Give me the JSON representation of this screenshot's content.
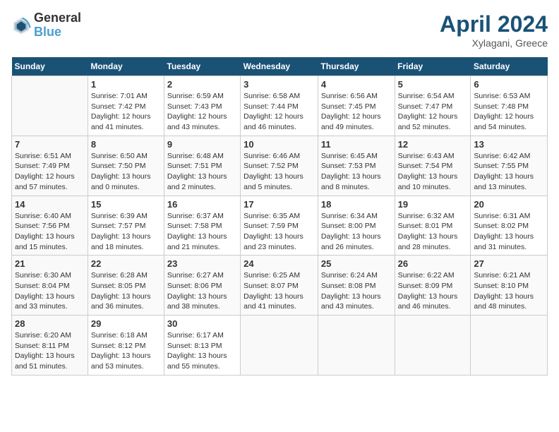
{
  "header": {
    "logo_line1": "General",
    "logo_line2": "Blue",
    "month": "April 2024",
    "location": "Xylagani, Greece"
  },
  "weekdays": [
    "Sunday",
    "Monday",
    "Tuesday",
    "Wednesday",
    "Thursday",
    "Friday",
    "Saturday"
  ],
  "weeks": [
    [
      {
        "day": "",
        "info": ""
      },
      {
        "day": "1",
        "info": "Sunrise: 7:01 AM\nSunset: 7:42 PM\nDaylight: 12 hours\nand 41 minutes."
      },
      {
        "day": "2",
        "info": "Sunrise: 6:59 AM\nSunset: 7:43 PM\nDaylight: 12 hours\nand 43 minutes."
      },
      {
        "day": "3",
        "info": "Sunrise: 6:58 AM\nSunset: 7:44 PM\nDaylight: 12 hours\nand 46 minutes."
      },
      {
        "day": "4",
        "info": "Sunrise: 6:56 AM\nSunset: 7:45 PM\nDaylight: 12 hours\nand 49 minutes."
      },
      {
        "day": "5",
        "info": "Sunrise: 6:54 AM\nSunset: 7:47 PM\nDaylight: 12 hours\nand 52 minutes."
      },
      {
        "day": "6",
        "info": "Sunrise: 6:53 AM\nSunset: 7:48 PM\nDaylight: 12 hours\nand 54 minutes."
      }
    ],
    [
      {
        "day": "7",
        "info": "Sunrise: 6:51 AM\nSunset: 7:49 PM\nDaylight: 12 hours\nand 57 minutes."
      },
      {
        "day": "8",
        "info": "Sunrise: 6:50 AM\nSunset: 7:50 PM\nDaylight: 13 hours\nand 0 minutes."
      },
      {
        "day": "9",
        "info": "Sunrise: 6:48 AM\nSunset: 7:51 PM\nDaylight: 13 hours\nand 2 minutes."
      },
      {
        "day": "10",
        "info": "Sunrise: 6:46 AM\nSunset: 7:52 PM\nDaylight: 13 hours\nand 5 minutes."
      },
      {
        "day": "11",
        "info": "Sunrise: 6:45 AM\nSunset: 7:53 PM\nDaylight: 13 hours\nand 8 minutes."
      },
      {
        "day": "12",
        "info": "Sunrise: 6:43 AM\nSunset: 7:54 PM\nDaylight: 13 hours\nand 10 minutes."
      },
      {
        "day": "13",
        "info": "Sunrise: 6:42 AM\nSunset: 7:55 PM\nDaylight: 13 hours\nand 13 minutes."
      }
    ],
    [
      {
        "day": "14",
        "info": "Sunrise: 6:40 AM\nSunset: 7:56 PM\nDaylight: 13 hours\nand 15 minutes."
      },
      {
        "day": "15",
        "info": "Sunrise: 6:39 AM\nSunset: 7:57 PM\nDaylight: 13 hours\nand 18 minutes."
      },
      {
        "day": "16",
        "info": "Sunrise: 6:37 AM\nSunset: 7:58 PM\nDaylight: 13 hours\nand 21 minutes."
      },
      {
        "day": "17",
        "info": "Sunrise: 6:35 AM\nSunset: 7:59 PM\nDaylight: 13 hours\nand 23 minutes."
      },
      {
        "day": "18",
        "info": "Sunrise: 6:34 AM\nSunset: 8:00 PM\nDaylight: 13 hours\nand 26 minutes."
      },
      {
        "day": "19",
        "info": "Sunrise: 6:32 AM\nSunset: 8:01 PM\nDaylight: 13 hours\nand 28 minutes."
      },
      {
        "day": "20",
        "info": "Sunrise: 6:31 AM\nSunset: 8:02 PM\nDaylight: 13 hours\nand 31 minutes."
      }
    ],
    [
      {
        "day": "21",
        "info": "Sunrise: 6:30 AM\nSunset: 8:04 PM\nDaylight: 13 hours\nand 33 minutes."
      },
      {
        "day": "22",
        "info": "Sunrise: 6:28 AM\nSunset: 8:05 PM\nDaylight: 13 hours\nand 36 minutes."
      },
      {
        "day": "23",
        "info": "Sunrise: 6:27 AM\nSunset: 8:06 PM\nDaylight: 13 hours\nand 38 minutes."
      },
      {
        "day": "24",
        "info": "Sunrise: 6:25 AM\nSunset: 8:07 PM\nDaylight: 13 hours\nand 41 minutes."
      },
      {
        "day": "25",
        "info": "Sunrise: 6:24 AM\nSunset: 8:08 PM\nDaylight: 13 hours\nand 43 minutes."
      },
      {
        "day": "26",
        "info": "Sunrise: 6:22 AM\nSunset: 8:09 PM\nDaylight: 13 hours\nand 46 minutes."
      },
      {
        "day": "27",
        "info": "Sunrise: 6:21 AM\nSunset: 8:10 PM\nDaylight: 13 hours\nand 48 minutes."
      }
    ],
    [
      {
        "day": "28",
        "info": "Sunrise: 6:20 AM\nSunset: 8:11 PM\nDaylight: 13 hours\nand 51 minutes."
      },
      {
        "day": "29",
        "info": "Sunrise: 6:18 AM\nSunset: 8:12 PM\nDaylight: 13 hours\nand 53 minutes."
      },
      {
        "day": "30",
        "info": "Sunrise: 6:17 AM\nSunset: 8:13 PM\nDaylight: 13 hours\nand 55 minutes."
      },
      {
        "day": "",
        "info": ""
      },
      {
        "day": "",
        "info": ""
      },
      {
        "day": "",
        "info": ""
      },
      {
        "day": "",
        "info": ""
      }
    ]
  ]
}
